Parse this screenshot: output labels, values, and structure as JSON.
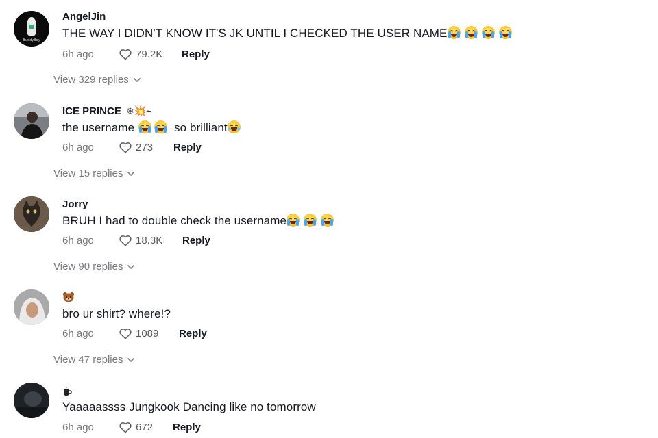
{
  "comments": [
    {
      "username": "AngelJin",
      "text": "THE WAY I DIDN'T KNOW IT'S JK UNTIL I CHECKED THE USER NAME",
      "emojis_after": [
        "loudly-crying-face",
        "loudly-crying-face",
        "loudly-crying-face",
        "loudly-crying-face"
      ],
      "time": "6h ago",
      "likes": "79.2K",
      "reply_label": "Reply",
      "view_replies": "View 329 replies",
      "avatar_icon": "avatar-logo-icon",
      "avatar_text": "BuddyBoy"
    },
    {
      "username": "ICE PRINCE",
      "username_suffix": "❄💥~",
      "text_parts": [
        "the username",
        "so brilliant"
      ],
      "time": "6h ago",
      "likes": "273",
      "reply_label": "Reply",
      "view_replies": "View 15 replies",
      "avatar_icon": "avatar-photo-icon"
    },
    {
      "username": "Jorry",
      "text": "BRUH I had to double check the username",
      "time": "6h ago",
      "likes": "18.3K",
      "reply_label": "Reply",
      "view_replies": "View 90 replies",
      "avatar_icon": "avatar-cat-icon"
    },
    {
      "username": "",
      "username_icon": "bear-face-icon",
      "text": "bro ur shirt? where!?",
      "time": "6h ago",
      "likes": "1089",
      "reply_label": "Reply",
      "view_replies": "View 47 replies",
      "avatar_icon": "avatar-photo-icon"
    },
    {
      "username": "",
      "username_icon": "coffee-cup-icon",
      "text": "Yaaaaassss Jungkook Dancing like no tomorrow",
      "time": "6h ago",
      "likes": "672",
      "reply_label": "Reply",
      "avatar_icon": "avatar-photo-icon"
    }
  ],
  "colors": {
    "text": "#161823",
    "muted": "#7a7b80",
    "background": "#ffffff"
  }
}
